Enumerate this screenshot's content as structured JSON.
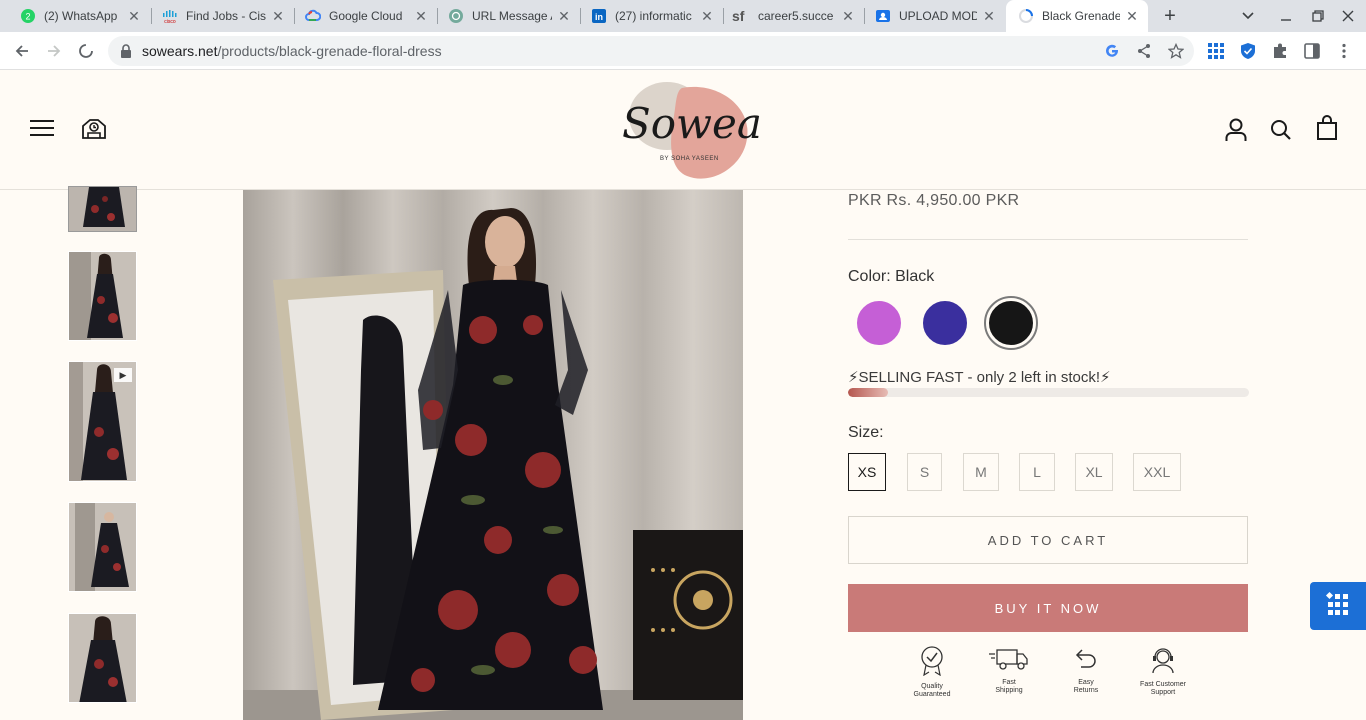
{
  "browser": {
    "tabs": [
      {
        "title": "(2) WhatsApp",
        "icon": "whatsapp-icon"
      },
      {
        "title": "Find Jobs - Cis",
        "icon": "cisco-icon"
      },
      {
        "title": "Google Cloud",
        "icon": "google-cloud-icon"
      },
      {
        "title": "URL Message A",
        "icon": "openai-icon"
      },
      {
        "title": "(27) informatic",
        "icon": "linkedin-icon"
      },
      {
        "title": "career5.succe",
        "icon": "successfactors-icon"
      },
      {
        "title": "UPLOAD MODI",
        "icon": "upload-icon"
      },
      {
        "title": "Black Grenade",
        "icon": "loading-icon"
      }
    ],
    "url_host": "sowears.net",
    "url_path": "/products/black-grenade-floral-dress"
  },
  "header": {
    "logo_text": "Sowears",
    "logo_subtext": "BY SOHA YASEEN"
  },
  "product": {
    "price": "PKR Rs. 4,950.00 PKR",
    "color_label": "Color: Black",
    "colors": [
      {
        "name": "Purple",
        "hex": "#c55fd6"
      },
      {
        "name": "Blue",
        "hex": "#3a2f9e"
      },
      {
        "name": "Black",
        "hex": "#161616"
      }
    ],
    "selected_color": "Black",
    "stock_message": "⚡SELLING FAST - only 2 left in stock!⚡",
    "stock_level": 0.1,
    "size_label": "Size:",
    "sizes": [
      "XS",
      "S",
      "M",
      "L",
      "XL",
      "XXL"
    ],
    "selected_size": "XS",
    "add_to_cart": "ADD TO CART",
    "buy_now": "BUY IT NOW",
    "badges": [
      {
        "label": "Quality\nGuaranteed",
        "icon": "quality-badge-icon"
      },
      {
        "label": "Fast\nShipping",
        "icon": "truck-icon"
      },
      {
        "label": "Easy\nReturns",
        "icon": "return-arrow-icon"
      },
      {
        "label": "Fast Customer\nSupport",
        "icon": "support-agent-icon"
      }
    ]
  },
  "colors": {
    "accent": "#c97a78",
    "background": "#fffbf5"
  }
}
